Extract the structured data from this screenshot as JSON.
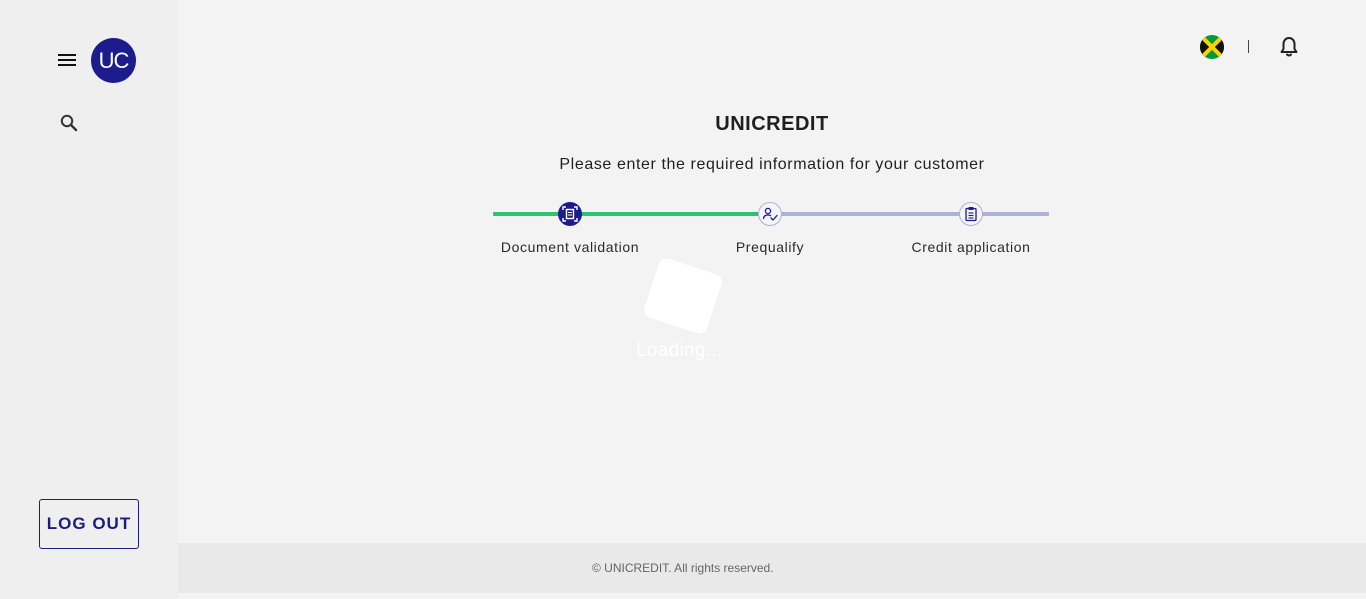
{
  "sidebar": {
    "menu_icon": "hamburger-menu-icon",
    "avatar_initials": "UC",
    "search_icon": "search-icon",
    "logout_label": "LOG OUT"
  },
  "topbar": {
    "flag_icon": "jamaica-flag-icon",
    "separator": "|",
    "bell_icon": "bell-icon"
  },
  "main": {
    "title": "UNICREDIT",
    "subtitle": "Please enter the required information for your customer"
  },
  "stepper": {
    "steps": [
      {
        "label": "Document validation",
        "icon": "document-scan-icon",
        "status": "active"
      },
      {
        "label": "Prequalify",
        "icon": "user-check-icon",
        "status": "pending"
      },
      {
        "label": "Credit application",
        "icon": "clipboard-icon",
        "status": "pending"
      }
    ]
  },
  "loading": {
    "text": "Loading..."
  },
  "footer": {
    "text": "© UNICREDIT. All rights reserved."
  },
  "colors": {
    "brand": "#1c1c8c",
    "progress_done": "#2ec16f",
    "progress_todo": "#aeb0d6"
  }
}
